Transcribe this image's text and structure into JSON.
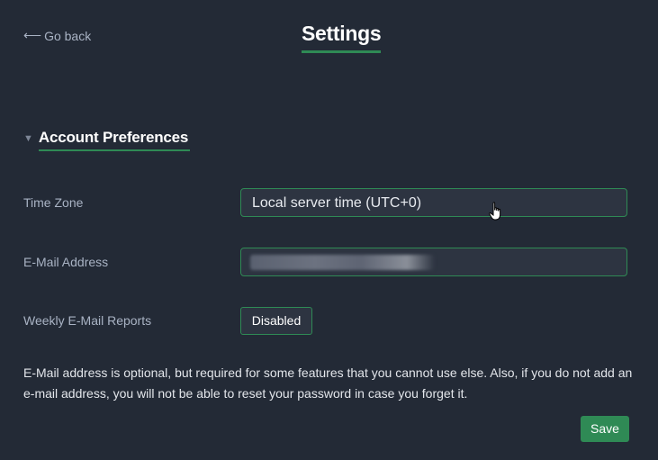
{
  "nav": {
    "back_arrow": "⟵",
    "back_label": "Go back"
  },
  "page": {
    "title": "Settings"
  },
  "section": {
    "title": "Account Preferences",
    "expanded": true
  },
  "fields": {
    "time_zone": {
      "label": "Time Zone",
      "value": "Local server time (UTC+0)"
    },
    "email": {
      "label": "E-Mail Address",
      "value": ""
    },
    "weekly_reports": {
      "label": "Weekly E-Mail Reports",
      "state": "Disabled"
    }
  },
  "note": "E-Mail address is optional, but required for some features that you cannot use else. Also, if you do not add an e-mail address, you will not be able to reset your password in case you forget it.",
  "actions": {
    "save_label": "Save"
  },
  "colors": {
    "background": "#232a36",
    "accent": "#2f8a55",
    "field_bg": "#2d3441"
  },
  "icons": {
    "cursor": "hand-pointer-icon",
    "section_toggle": "triangle-down-icon"
  }
}
